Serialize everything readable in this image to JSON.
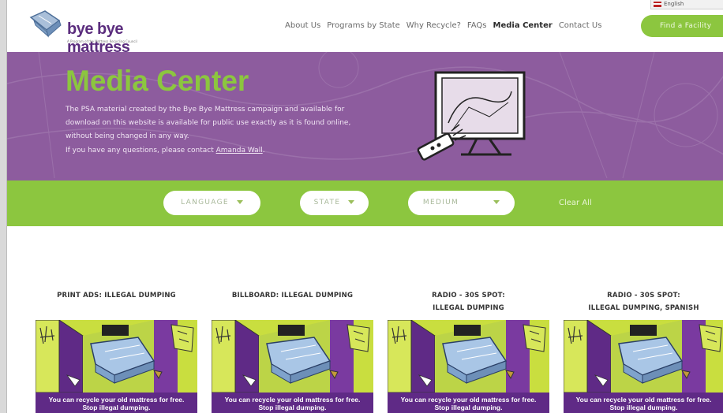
{
  "header": {
    "logo_text": "bye bye mattress",
    "logo_tagline": "A Program of the Mattress Recycling Council",
    "language_chip": "English",
    "nav": [
      "About Us",
      "Programs by State",
      "Why Recycle?",
      "FAQs",
      "Media Center",
      "Contact Us"
    ],
    "active_nav": "Media Center",
    "find_button": "Find a Facility"
  },
  "hero": {
    "title": "Media Center",
    "description": "The PSA material created by the Bye Bye Mattress campaign and available for download on this website is available for public use exactly as it is found online, without being changed in any way.",
    "contact_prefix": "If you have any questions, please contact ",
    "contact_link": "Amanda Wall",
    "contact_suffix": "."
  },
  "filters": {
    "language": "LANGUAGE",
    "state": "STATE",
    "medium": "MEDIUM",
    "clear": "Clear All"
  },
  "cards": [
    {
      "title_line1": "PRINT ADS: ILLEGAL DUMPING",
      "title_line2": "",
      "caption_line1": "You can recycle your old mattress for free.",
      "caption_line2": "Stop illegal dumping."
    },
    {
      "title_line1": "BILLBOARD: ILLEGAL DUMPING",
      "title_line2": "",
      "caption_line1": "You can recycle your old mattress for free.",
      "caption_line2": "Stop illegal dumping."
    },
    {
      "title_line1": "RADIO - 30S SPOT:",
      "title_line2": "ILLEGAL DUMPING",
      "caption_line1": "You can recycle your old mattress for free.",
      "caption_line2": "Stop illegal dumping."
    },
    {
      "title_line1": "RADIO - 30S SPOT:",
      "title_line2": "ILLEGAL DUMPING, SPANISH",
      "caption_line1": "You can recycle your old mattress for free.",
      "caption_line2": "Stop illegal dumping."
    }
  ],
  "colors": {
    "purple": "#8d5c9e",
    "green": "#8cc63f",
    "dark_purple": "#5f2a86",
    "poster_yellow": "#c9de3f"
  }
}
